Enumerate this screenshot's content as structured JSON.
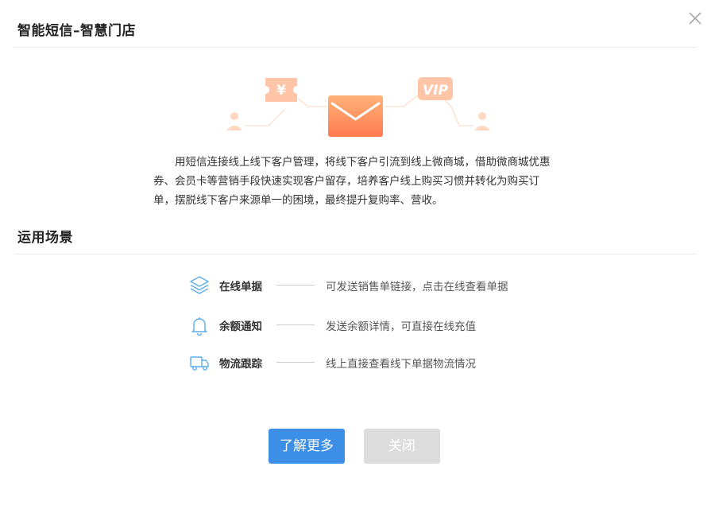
{
  "dialog": {
    "title": "智能短信–智慧门店",
    "close_icon": "close-icon"
  },
  "illustration": {
    "coupon_symbol": "¥",
    "vip_label": "VIP",
    "colors": {
      "envelope_top": "#ffb37a",
      "envelope_bottom": "#ff7a4e",
      "badge": "#ffc5a6",
      "person": "#ffd8c2",
      "line": "#ffd6c0"
    }
  },
  "intro": {
    "text": "用短信连接线上线下客户管理，将线下客户引流到线上微商城，借助微商城优惠券、会员卡等营销手段快速实现客户留存，培养客户线上购买习惯并转化为购买订单，摆脱线下客户来源单一的困境，最终提升复购率、营收。"
  },
  "scenes": {
    "title": "运用场景",
    "items": [
      {
        "icon": "layers-icon",
        "label": "在线单据",
        "desc": "可发送销售单链接，点击在线查看单据"
      },
      {
        "icon": "bell-icon",
        "label": "余额通知",
        "desc": "发送余额详情，可直接在线充值"
      },
      {
        "icon": "truck-icon",
        "label": "物流跟踪",
        "desc": "线上直接查看线下单据物流情况"
      }
    ],
    "icon_color": "#5aaee8"
  },
  "buttons": {
    "learn_more": "了解更多",
    "close": "关闭",
    "primary_color": "#3d8ee6",
    "secondary_color": "#dcdcdc"
  }
}
